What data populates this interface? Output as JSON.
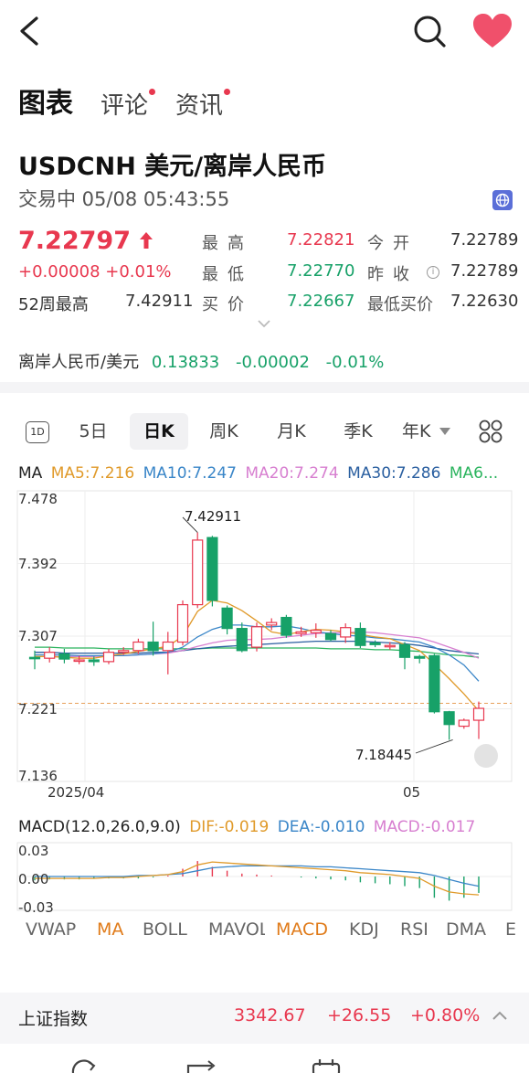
{
  "tabs": [
    {
      "label": "图表",
      "active": true,
      "dot": false
    },
    {
      "label": "评论",
      "active": false,
      "dot": true
    },
    {
      "label": "资讯",
      "active": false,
      "dot": true
    }
  ],
  "symbol": "USDCNH 美元/离岸人民币",
  "status": "交易中  05/08 05:43:55",
  "price": "7.22797",
  "change": "+0.00008  +0.01%",
  "week52_label": "52周最高",
  "week52_value": "7.42911",
  "quote": {
    "high_label": "最高",
    "high_value": "7.22821",
    "low_label": "最低",
    "low_value": "7.22770",
    "bid_label": "买价",
    "bid_value": "7.22667",
    "open_label": "今开",
    "open_value": "7.22789",
    "prev_label": "昨收",
    "prev_value": "7.22789",
    "lowbid_label": "最低买价",
    "lowbid_value": "7.22630"
  },
  "offshore": {
    "label": "离岸人民币/美元",
    "value": "0.13833",
    "change": "-0.00002",
    "pct": "-0.01%"
  },
  "periods": [
    "1D",
    "5日",
    "日K",
    "周K",
    "月K",
    "季K",
    "年K"
  ],
  "ma_legend": {
    "label": "MA",
    "ma5": "MA5:7.216",
    "ma10": "MA10:7.247",
    "ma20": "MA20:7.274",
    "ma30": "MA30:7.286",
    "ma60": "MA6..."
  },
  "y_labels": [
    "7.478",
    "7.392",
    "7.307",
    "7.221",
    "7.136"
  ],
  "x_labels": [
    "2025/04",
    "05"
  ],
  "annotations": {
    "high": "7.42911",
    "low": "7.18445"
  },
  "macd_legend": {
    "label": "MACD(12.0,26.0,9.0)",
    "dif": "DIF:-0.019",
    "dea": "DEA:-0.010",
    "macd": "MACD:-0.017"
  },
  "macd_y_labels": [
    "0.03",
    "0.00",
    "-0.03"
  ],
  "indicators": [
    "VWAP",
    "MA",
    "BOLL",
    "MAVOL",
    "MACD",
    "KDJ",
    "RSI",
    "DMA",
    "E"
  ],
  "index": {
    "name": "上证指数",
    "value": "3342.67",
    "change": "+26.55",
    "pct": "+0.80%"
  },
  "colors": {
    "up": "#e8384f",
    "down": "#17a168",
    "ma5": "#e09a2a",
    "ma10": "#3a86c8",
    "ma20": "#d77fd0",
    "ma30": "#2a5fa0",
    "ma60": "#2bb45e",
    "accent": "#e07b1a"
  },
  "chart_data": {
    "type": "candlestick",
    "ylim": [
      7.136,
      7.478
    ],
    "candles": [
      {
        "o": 7.282,
        "c": 7.281,
        "h": 7.29,
        "l": 7.268
      },
      {
        "o": 7.281,
        "c": 7.288,
        "h": 7.294,
        "l": 7.276
      },
      {
        "o": 7.286,
        "c": 7.28,
        "h": 7.292,
        "l": 7.275
      },
      {
        "o": 7.279,
        "c": 7.279,
        "h": 7.284,
        "l": 7.274
      },
      {
        "o": 7.279,
        "c": 7.277,
        "h": 7.283,
        "l": 7.272
      },
      {
        "o": 7.277,
        "c": 7.288,
        "h": 7.292,
        "l": 7.274
      },
      {
        "o": 7.288,
        "c": 7.29,
        "h": 7.294,
        "l": 7.285
      },
      {
        "o": 7.29,
        "c": 7.3,
        "h": 7.304,
        "l": 7.286
      },
      {
        "o": 7.3,
        "c": 7.29,
        "h": 7.324,
        "l": 7.284
      },
      {
        "o": 7.29,
        "c": 7.3,
        "h": 7.312,
        "l": 7.262
      },
      {
        "o": 7.3,
        "c": 7.344,
        "h": 7.349,
        "l": 7.296
      },
      {
        "o": 7.344,
        "c": 7.42,
        "h": 7.429,
        "l": 7.34
      },
      {
        "o": 7.423,
        "c": 7.349,
        "h": 7.425,
        "l": 7.342
      },
      {
        "o": 7.34,
        "c": 7.316,
        "h": 7.343,
        "l": 7.309
      },
      {
        "o": 7.316,
        "c": 7.29,
        "h": 7.323,
        "l": 7.288
      },
      {
        "o": 7.294,
        "c": 7.318,
        "h": 7.323,
        "l": 7.289
      },
      {
        "o": 7.32,
        "c": 7.323,
        "h": 7.328,
        "l": 7.314
      },
      {
        "o": 7.329,
        "c": 7.308,
        "h": 7.332,
        "l": 7.305
      },
      {
        "o": 7.31,
        "c": 7.312,
        "h": 7.318,
        "l": 7.306
      },
      {
        "o": 7.311,
        "c": 7.314,
        "h": 7.322,
        "l": 7.305
      },
      {
        "o": 7.31,
        "c": 7.303,
        "h": 7.314,
        "l": 7.301
      },
      {
        "o": 7.306,
        "c": 7.317,
        "h": 7.322,
        "l": 7.299
      },
      {
        "o": 7.316,
        "c": 7.296,
        "h": 7.323,
        "l": 7.293
      },
      {
        "o": 7.299,
        "c": 7.297,
        "h": 7.302,
        "l": 7.294
      },
      {
        "o": 7.296,
        "c": 7.296,
        "h": 7.3,
        "l": 7.291
      },
      {
        "o": 7.297,
        "c": 7.282,
        "h": 7.3,
        "l": 7.268
      },
      {
        "o": 7.283,
        "c": 7.281,
        "h": 7.285,
        "l": 7.275
      },
      {
        "o": 7.284,
        "c": 7.218,
        "h": 7.286,
        "l": 7.216
      },
      {
        "o": 7.218,
        "c": 7.203,
        "h": 7.219,
        "l": 7.185
      },
      {
        "o": 7.201,
        "c": 7.208,
        "h": 7.21,
        "l": 7.198
      },
      {
        "o": 7.208,
        "c": 7.222,
        "h": 7.23,
        "l": 7.186
      }
    ],
    "ma5": [
      7.283,
      7.283,
      7.282,
      7.281,
      7.281,
      7.284,
      7.286,
      7.289,
      7.292,
      7.295,
      7.307,
      7.336,
      7.349,
      7.346,
      7.337,
      7.325,
      7.312,
      7.309,
      7.312,
      7.315,
      7.314,
      7.312,
      7.309,
      7.306,
      7.304,
      7.297,
      7.29,
      7.274,
      7.257,
      7.239,
      7.219
    ],
    "ma10": [
      7.285,
      7.285,
      7.285,
      7.284,
      7.284,
      7.284,
      7.284,
      7.285,
      7.286,
      7.288,
      7.294,
      7.306,
      7.315,
      7.32,
      7.32,
      7.318,
      7.318,
      7.319,
      7.316,
      7.312,
      7.31,
      7.308,
      7.307,
      7.305,
      7.304,
      7.302,
      7.3,
      7.294,
      7.285,
      7.273,
      7.254
    ],
    "ma20": [
      7.283,
      7.283,
      7.283,
      7.283,
      7.283,
      7.284,
      7.284,
      7.285,
      7.286,
      7.287,
      7.29,
      7.295,
      7.299,
      7.302,
      7.303,
      7.303,
      7.304,
      7.306,
      7.308,
      7.31,
      7.311,
      7.311,
      7.312,
      7.311,
      7.309,
      7.307,
      7.305,
      7.3,
      7.294,
      7.288,
      7.281
    ],
    "ma30": [
      7.288,
      7.288,
      7.287,
      7.287,
      7.287,
      7.287,
      7.287,
      7.287,
      7.288,
      7.288,
      7.29,
      7.292,
      7.294,
      7.295,
      7.296,
      7.297,
      7.298,
      7.299,
      7.3,
      7.301,
      7.301,
      7.301,
      7.301,
      7.3,
      7.299,
      7.298,
      7.296,
      7.293,
      7.29,
      7.288,
      7.286
    ],
    "ma60": [
      7.294,
      7.294,
      7.293,
      7.293,
      7.293,
      7.292,
      7.292,
      7.292,
      7.292,
      7.292,
      7.292,
      7.292,
      7.293,
      7.293,
      7.293,
      7.293,
      7.293,
      7.293,
      7.293,
      7.293,
      7.292,
      7.292,
      7.292,
      7.291,
      7.291,
      7.29,
      7.289,
      7.287,
      7.285,
      7.284,
      7.282
    ],
    "last_price": 7.228,
    "macd": {
      "ylim": [
        -0.035,
        0.035
      ],
      "hist": [
        -0.004,
        -0.003,
        -0.003,
        -0.003,
        -0.002,
        -0.002,
        -0.002,
        -0.002,
        -0.001,
        0.001,
        0.008,
        0.016,
        0.01,
        0.006,
        0.003,
        0.002,
        0.001,
        0.0,
        -0.001,
        -0.002,
        -0.003,
        -0.004,
        -0.006,
        -0.007,
        -0.008,
        -0.01,
        -0.012,
        -0.022,
        -0.025,
        -0.022,
        -0.017
      ],
      "dif": [
        -0.002,
        -0.002,
        -0.002,
        -0.002,
        -0.002,
        -0.001,
        -0.001,
        0.0,
        0.001,
        0.002,
        0.005,
        0.012,
        0.015,
        0.014,
        0.013,
        0.012,
        0.011,
        0.01,
        0.009,
        0.008,
        0.007,
        0.006,
        0.004,
        0.003,
        0.002,
        0.0,
        -0.002,
        -0.01,
        -0.016,
        -0.018,
        -0.019
      ],
      "dea": [
        0.0,
        0.0,
        0.0,
        0.0,
        0.0,
        0.0,
        0.0,
        0.001,
        0.001,
        0.002,
        0.003,
        0.006,
        0.009,
        0.01,
        0.011,
        0.011,
        0.011,
        0.011,
        0.011,
        0.01,
        0.01,
        0.009,
        0.008,
        0.007,
        0.006,
        0.005,
        0.004,
        0.001,
        -0.003,
        -0.007,
        -0.01
      ]
    }
  }
}
